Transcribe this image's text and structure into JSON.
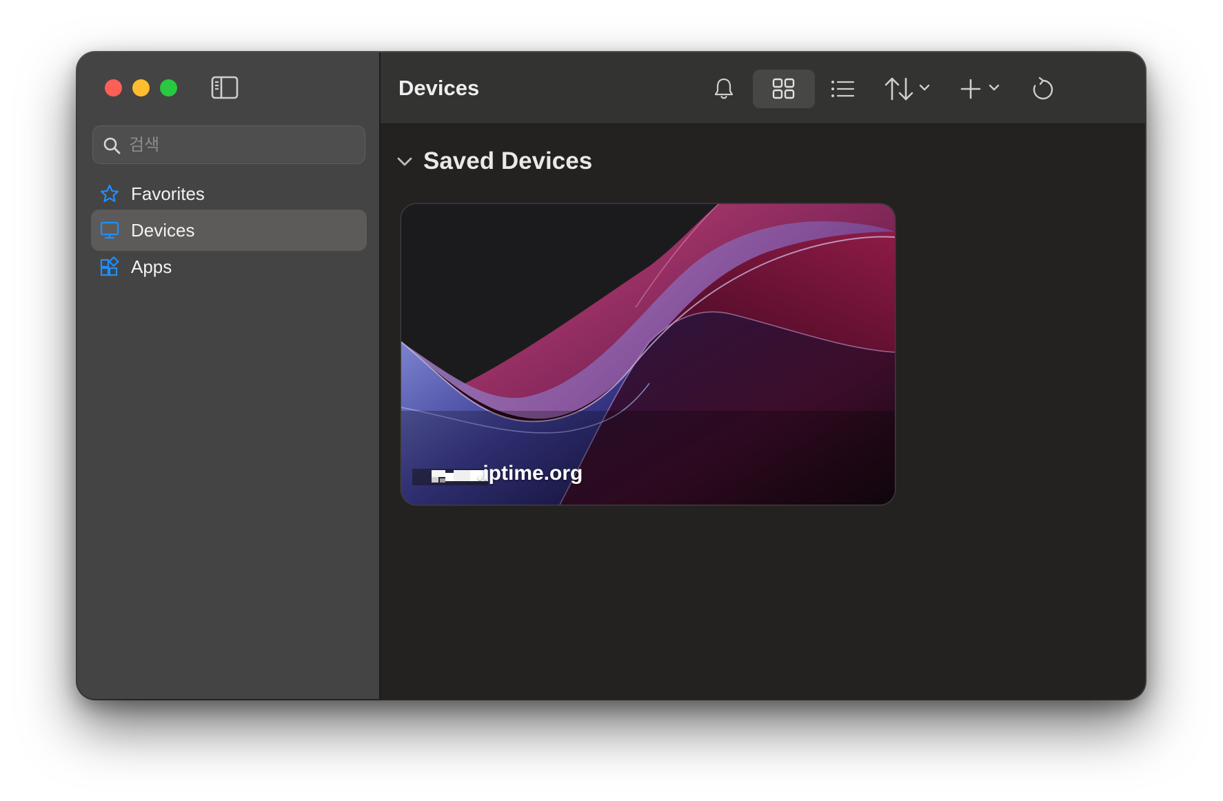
{
  "sidebar": {
    "search": {
      "placeholder": "검색",
      "value": ""
    },
    "items": [
      {
        "label": "Favorites",
        "icon": "star-icon",
        "active": false
      },
      {
        "label": "Devices",
        "icon": "monitor-icon",
        "active": true
      },
      {
        "label": "Apps",
        "icon": "apps-grid-icon",
        "active": false
      }
    ]
  },
  "toolbar": {
    "title": "Devices",
    "buttons": [
      {
        "name": "notifications",
        "icon": "bell-icon"
      },
      {
        "name": "grid-view",
        "icon": "grid-icon",
        "selected": true
      },
      {
        "name": "list-view",
        "icon": "list-icon"
      },
      {
        "name": "sort",
        "icon": "sort-arrows-icon"
      },
      {
        "name": "add",
        "icon": "plus-icon"
      },
      {
        "name": "refresh",
        "icon": "refresh-icon"
      }
    ]
  },
  "main": {
    "section": {
      "title": "Saved Devices",
      "expanded": true
    },
    "devices": [
      {
        "label": ".iptime.org",
        "thumbnail": "purple-wave-wallpaper"
      }
    ]
  },
  "colors": {
    "accent": "#1e90ff",
    "sidebar_bg": "#444444",
    "content_bg": "#232220",
    "traffic_red": "#fe5f57",
    "traffic_yellow": "#febc2e",
    "traffic_green": "#28c840"
  }
}
